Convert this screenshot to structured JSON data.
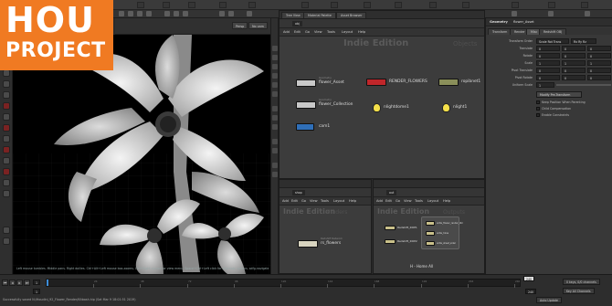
{
  "logo": {
    "line1": "HOU",
    "line2": "PROJECT"
  },
  "viewport": {
    "menu_persp": "Persp",
    "menu_cam": "No cam",
    "status": "Left mouse tumbles. Middle pans. Right dollies. Ctrl+Alt+Left mouse box-zooms. Ctrl+Right mouse for view menu. Space+Ctrl+Left click for alternate options. sdfg-navigate"
  },
  "network_obj": {
    "tabs": [
      "Tree View",
      "Material Palette",
      "Asset Browser"
    ],
    "path": "obj",
    "menu": [
      "Add",
      "Edit",
      "Go",
      "View",
      "Tools",
      "Layout",
      "Help"
    ],
    "big_title": "Indie Edition",
    "context_title": "Objects",
    "nodes": [
      {
        "name": "flower_Asset",
        "sub": "Geometry",
        "color": "#c8c8c8"
      },
      {
        "name": "RENDER_FLOWERS",
        "sub": "",
        "color": "#c0262a"
      },
      {
        "name": "ropibnet1",
        "sub": "",
        "color": "#8a8f5a"
      },
      {
        "name": "flower_Collection",
        "sub": "Geometry",
        "color": "#c8c8c8"
      },
      {
        "name": "nlightdome1",
        "sub": "",
        "color": "#f2d84a"
      },
      {
        "name": "nlight1",
        "sub": "",
        "color": "#f2d84a"
      },
      {
        "name": "cam1",
        "sub": "",
        "color": "#2f6fb8"
      }
    ]
  },
  "network_shop": {
    "path": "shop",
    "menu": [
      "Add",
      "Edit",
      "Go",
      "View",
      "Tools",
      "Layout",
      "Help"
    ],
    "big_title": "Indie Edition",
    "context_title": "Shaders",
    "node": {
      "name": "rs_flowers",
      "sub": "Redshift Network"
    }
  },
  "network_out": {
    "path": "out",
    "menu": [
      "Add",
      "Edit",
      "Go",
      "View",
      "Tools",
      "Layout",
      "Help"
    ],
    "big_title": "Indie Edition",
    "context_title": "Outputs",
    "left_nodes": [
      "Redshift_ROP1",
      "Redshift_ROP2"
    ],
    "box_nodes": [
      "write_flower_render_dbl",
      "write_hires",
      "write_sheet_sider"
    ],
    "footer": "H - Home All"
  },
  "params": {
    "header": "Geometry",
    "node_name": "flower_Asset",
    "tabs": [
      "Transform",
      "Render",
      "Misc",
      "Redshift OBJ"
    ],
    "rows": [
      {
        "label": "Transform Order",
        "values": [
          "Scale Rot Trans",
          "Rx Ry Rz"
        ]
      },
      {
        "label": "Translate",
        "values": [
          "0",
          "0",
          "0"
        ]
      },
      {
        "label": "Rotate",
        "values": [
          "0",
          "0",
          "0"
        ]
      },
      {
        "label": "Scale",
        "values": [
          "1",
          "1",
          "1"
        ]
      },
      {
        "label": "Pivot Translate",
        "values": [
          "0",
          "0",
          "0"
        ]
      },
      {
        "label": "Pivot Rotate",
        "values": [
          "0",
          "0",
          "0"
        ]
      },
      {
        "label": "Uniform Scale",
        "values": [
          "1"
        ]
      }
    ],
    "dropdown": "Modify Pre-Transform",
    "checks": [
      "Keep Position When Parenting",
      "Child Compensation",
      "Enable Constraints"
    ]
  },
  "timeline": {
    "start_frame": "1",
    "current_frame": "1",
    "end_frame": "240",
    "end_frame_b": "240",
    "ticks": [
      "24",
      "48",
      "72",
      "96",
      "120",
      "144",
      "168",
      "192",
      "216",
      "240"
    ],
    "status": "Successfully saved N:/Houdini_92_Flower_Render/Kitbash.hip (Sat Mar 9 18:01:51 2019)",
    "keys_label": "0 keys, 0/0 channels",
    "key_all": "Key All Channels",
    "auto_update": "Auto Update"
  }
}
